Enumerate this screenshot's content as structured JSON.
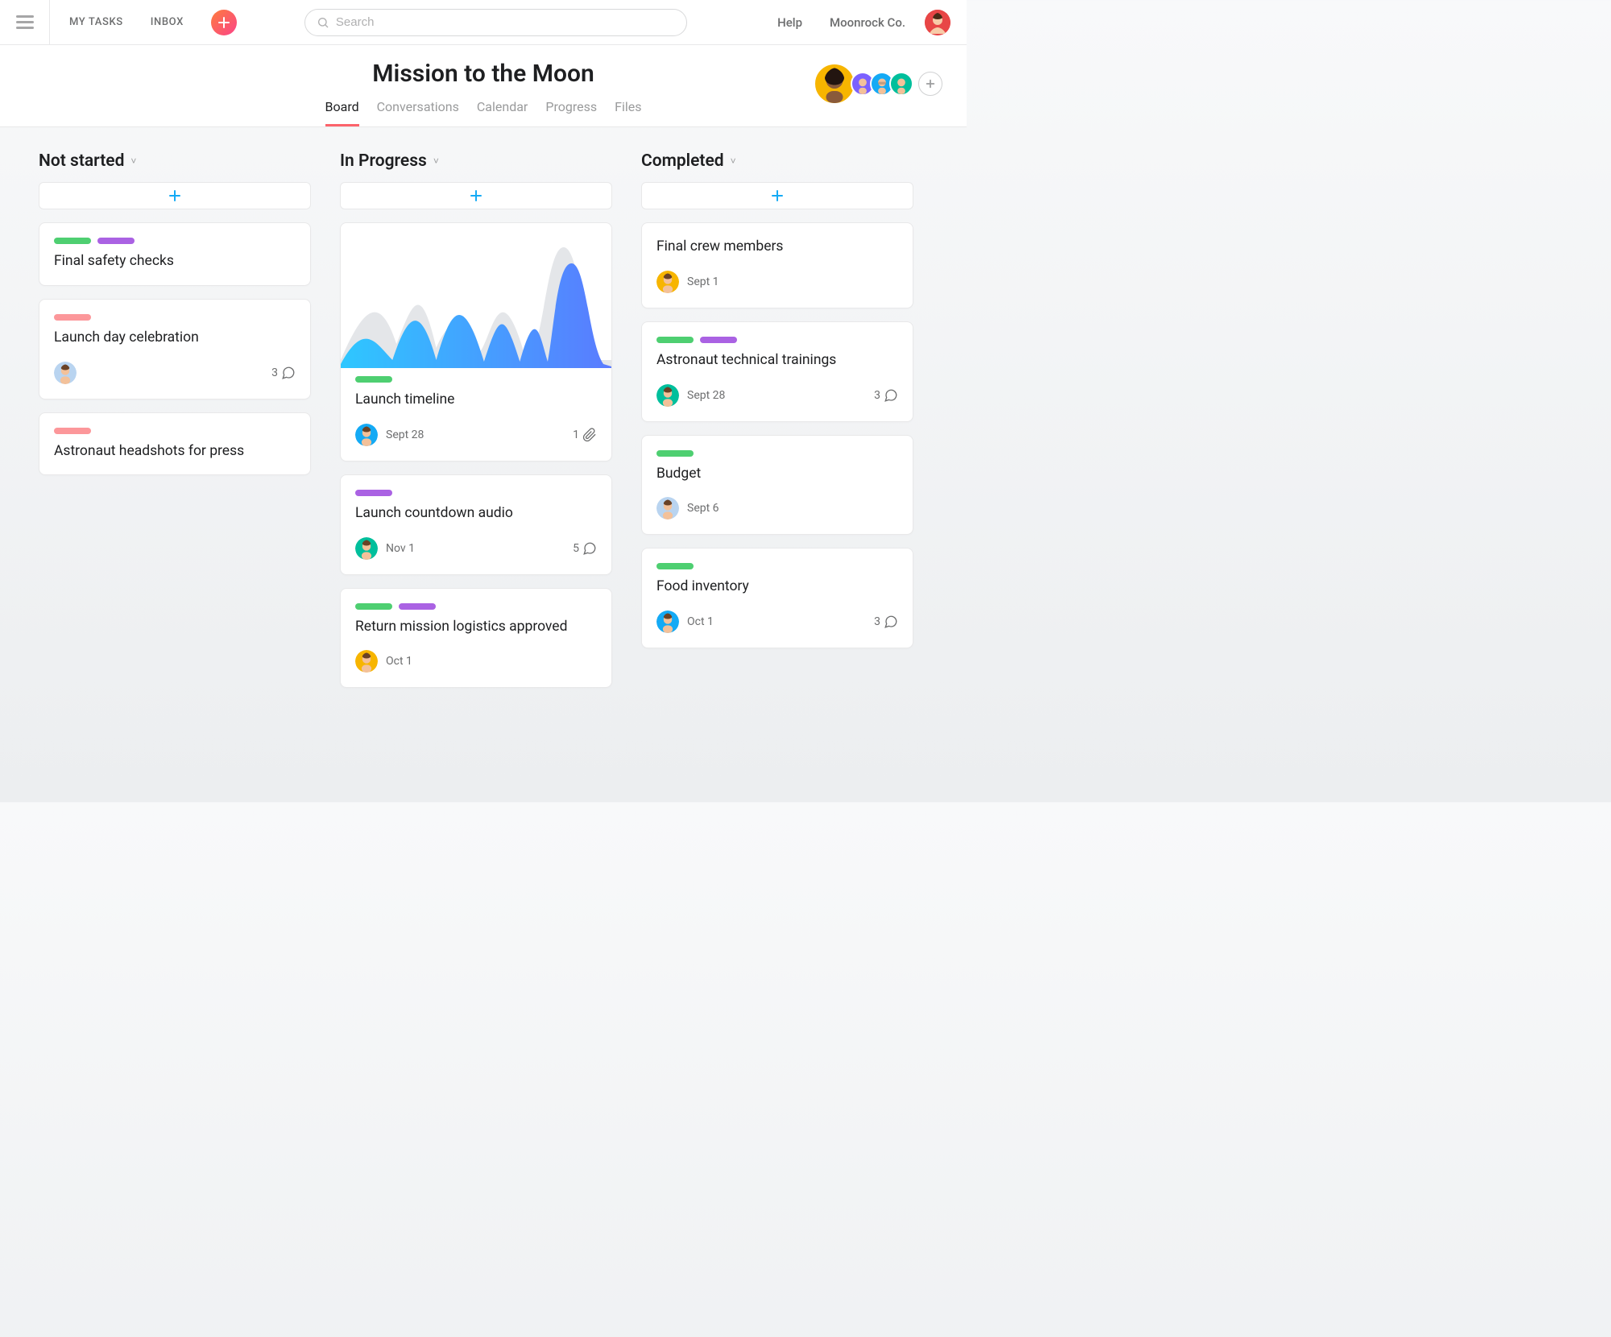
{
  "topnav": {
    "my_tasks": "MY TASKS",
    "inbox": "INBOX",
    "search_placeholder": "Search",
    "help": "Help",
    "org": "Moonrock Co."
  },
  "project": {
    "title": "Mission to the Moon",
    "tabs": [
      "Board",
      "Conversations",
      "Calendar",
      "Progress",
      "Files"
    ],
    "active_tab": 0,
    "members": [
      {
        "bg": "#f7b500"
      },
      {
        "bg": "#7b61ff"
      },
      {
        "bg": "#14aaf5"
      },
      {
        "bg": "#00bf9c"
      }
    ]
  },
  "columns": [
    {
      "name": "Not started",
      "cards": [
        {
          "tags": [
            "green",
            "purple"
          ],
          "title": "Final safety checks"
        },
        {
          "tags": [
            "pink"
          ],
          "title": "Launch day celebration",
          "assignee_bg": "#b9d4f0",
          "comments": 3
        },
        {
          "tags": [
            "pink"
          ],
          "title": "Astronaut headshots for press"
        }
      ]
    },
    {
      "name": "In Progress",
      "cards": [
        {
          "chart": true,
          "tags": [
            "green"
          ],
          "title": "Launch timeline",
          "assignee_bg": "#14aaf5",
          "due": "Sept 28",
          "attachments": 1
        },
        {
          "tags": [
            "purple"
          ],
          "title": "Launch countdown audio",
          "assignee_bg": "#00bf9c",
          "due": "Nov 1",
          "comments": 5
        },
        {
          "tags": [
            "green",
            "purple"
          ],
          "title": "Return mission logistics approved",
          "assignee_bg": "#f7b500",
          "due": "Oct 1"
        }
      ]
    },
    {
      "name": "Completed",
      "cards": [
        {
          "title": "Final crew members",
          "assignee_bg": "#f7b500",
          "due": "Sept 1"
        },
        {
          "tags": [
            "green",
            "purple"
          ],
          "title": "Astronaut technical trainings",
          "assignee_bg": "#00bf9c",
          "due": "Sept 28",
          "comments": 3
        },
        {
          "tags": [
            "green"
          ],
          "title": "Budget",
          "assignee_bg": "#b9d4f0",
          "due": "Sept 6"
        },
        {
          "tags": [
            "green"
          ],
          "title": "Food inventory",
          "assignee_bg": "#14aaf5",
          "due": "Oct 1",
          "comments": 3
        }
      ]
    }
  ]
}
